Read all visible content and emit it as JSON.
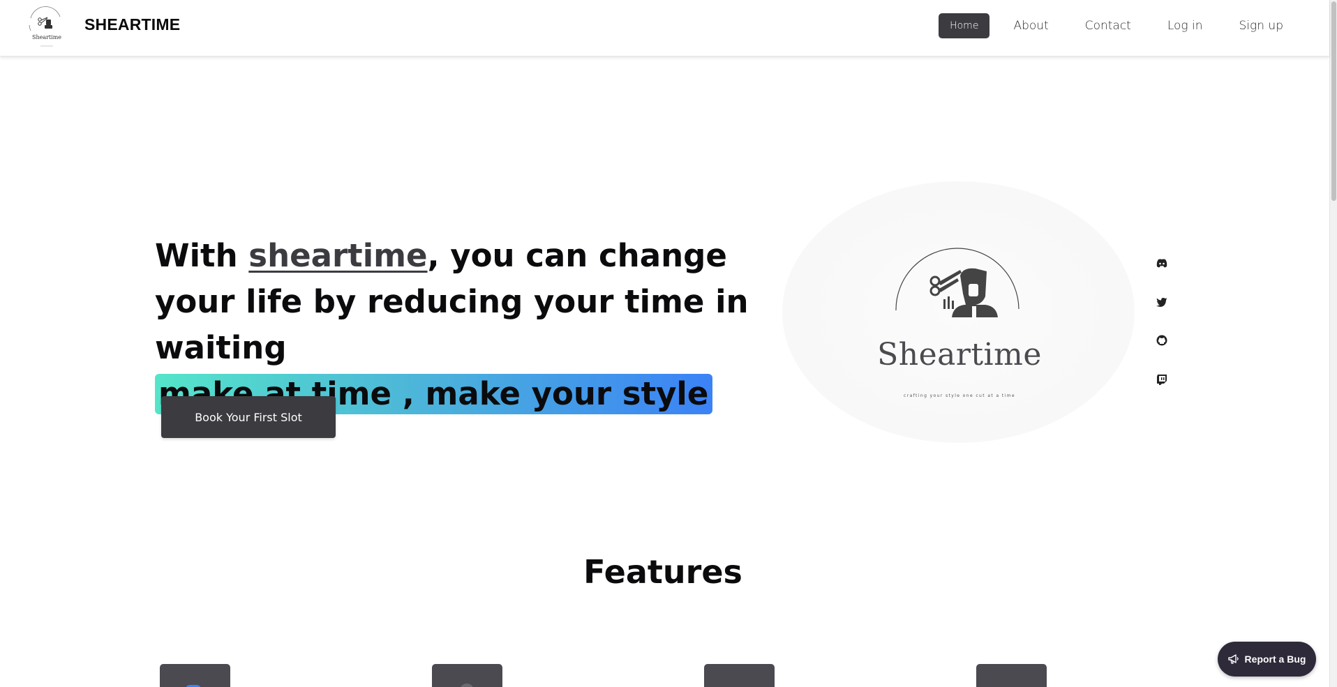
{
  "header": {
    "brand": "SHEARTIME",
    "logo_text": "Sheartime",
    "nav": [
      {
        "label": "Home",
        "active": true
      },
      {
        "label": "About",
        "active": false
      },
      {
        "label": "Contact",
        "active": false
      },
      {
        "label": "Log in",
        "active": false
      },
      {
        "label": "Sign up",
        "active": false
      }
    ]
  },
  "hero": {
    "title_prefix": "With ",
    "title_highlight_word": "sheartime",
    "title_suffix": ", you can change your life by reducing your time in waiting",
    "title_gradient": "make at time , make your style",
    "cta_label": "Book Your First Slot",
    "logo_name": "Sheartime",
    "logo_tagline": "crafting your style one cut at a time"
  },
  "social": [
    {
      "icon": "discord-icon"
    },
    {
      "icon": "twitter-icon"
    },
    {
      "icon": "github-icon"
    },
    {
      "icon": "twitch-icon"
    }
  ],
  "features": {
    "title": "Features"
  },
  "report_bug": {
    "label": "Report a Bug",
    "icon": "megaphone-icon"
  },
  "colors": {
    "primary": "#3b3b40",
    "gradient_start": "#55e5c9",
    "gradient_end": "#3b82f6",
    "bug_button": "#2f2a3a"
  }
}
